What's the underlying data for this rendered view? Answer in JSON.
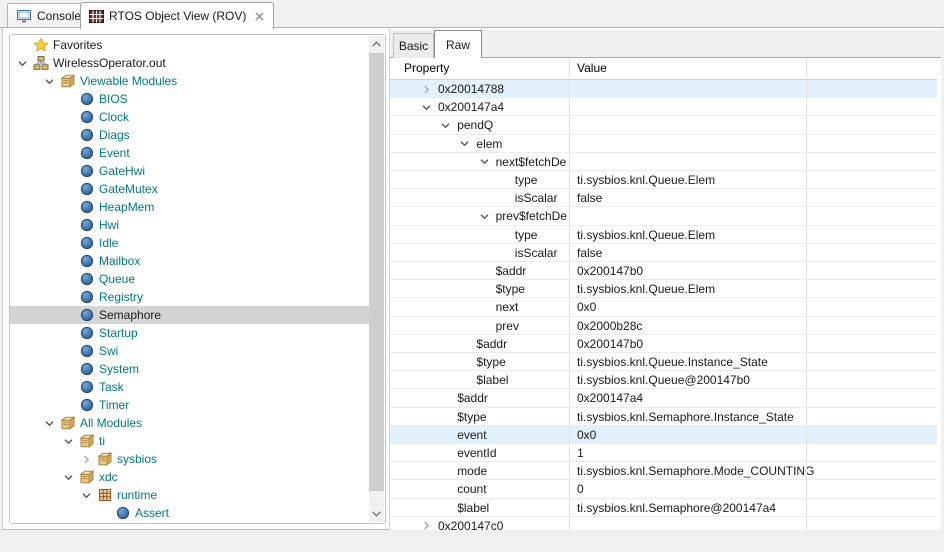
{
  "window": {
    "tabs": [
      {
        "label": "Console",
        "icon": "console-icon",
        "active": false
      },
      {
        "label": "RTOS Object View (ROV)",
        "icon": "table-grid-icon",
        "active": true,
        "closable": true
      }
    ]
  },
  "colors": {
    "module_teal": "#007a7a",
    "tree_selection": "#d4d4d4",
    "row_highlight": "#e3f1fc"
  },
  "tree": {
    "items": [
      {
        "label": "Favorites",
        "icon": "star",
        "level": 0,
        "chevron": "none",
        "color": "default"
      },
      {
        "label": "WirelessOperator.out",
        "icon": "hierarchy",
        "level": 0,
        "chevron": "expanded",
        "color": "default"
      },
      {
        "label": "Viewable Modules",
        "icon": "package",
        "level": 1,
        "chevron": "expanded",
        "color": "teal"
      },
      {
        "label": "BIOS",
        "icon": "module",
        "level": 2,
        "chevron": "none",
        "color": "teal"
      },
      {
        "label": "Clock",
        "icon": "module",
        "level": 2,
        "chevron": "none",
        "color": "teal"
      },
      {
        "label": "Diags",
        "icon": "module",
        "level": 2,
        "chevron": "none",
        "color": "teal"
      },
      {
        "label": "Event",
        "icon": "module",
        "level": 2,
        "chevron": "none",
        "color": "teal"
      },
      {
        "label": "GateHwi",
        "icon": "module",
        "level": 2,
        "chevron": "none",
        "color": "teal"
      },
      {
        "label": "GateMutex",
        "icon": "module",
        "level": 2,
        "chevron": "none",
        "color": "teal"
      },
      {
        "label": "HeapMem",
        "icon": "module",
        "level": 2,
        "chevron": "none",
        "color": "teal"
      },
      {
        "label": "Hwi",
        "icon": "module",
        "level": 2,
        "chevron": "none",
        "color": "teal"
      },
      {
        "label": "Idle",
        "icon": "module",
        "level": 2,
        "chevron": "none",
        "color": "teal"
      },
      {
        "label": "Mailbox",
        "icon": "module",
        "level": 2,
        "chevron": "none",
        "color": "teal"
      },
      {
        "label": "Queue",
        "icon": "module",
        "level": 2,
        "chevron": "none",
        "color": "teal"
      },
      {
        "label": "Registry",
        "icon": "module",
        "level": 2,
        "chevron": "none",
        "color": "teal"
      },
      {
        "label": "Semaphore",
        "icon": "module",
        "level": 2,
        "chevron": "none",
        "color": "default",
        "selected": true
      },
      {
        "label": "Startup",
        "icon": "module",
        "level": 2,
        "chevron": "none",
        "color": "teal"
      },
      {
        "label": "Swi",
        "icon": "module",
        "level": 2,
        "chevron": "none",
        "color": "teal"
      },
      {
        "label": "System",
        "icon": "module",
        "level": 2,
        "chevron": "none",
        "color": "teal"
      },
      {
        "label": "Task",
        "icon": "module",
        "level": 2,
        "chevron": "none",
        "color": "teal"
      },
      {
        "label": "Timer",
        "icon": "module",
        "level": 2,
        "chevron": "none",
        "color": "teal"
      },
      {
        "label": "All Modules",
        "icon": "package",
        "level": 1,
        "chevron": "expanded",
        "color": "teal"
      },
      {
        "label": "ti",
        "icon": "package",
        "level": 2,
        "chevron": "expanded",
        "color": "teal"
      },
      {
        "label": "sysbios",
        "icon": "package",
        "level": 3,
        "chevron": "collapsed",
        "color": "teal"
      },
      {
        "label": "xdc",
        "icon": "package",
        "level": 2,
        "chevron": "expanded",
        "color": "teal"
      },
      {
        "label": "runtime",
        "icon": "grid-module",
        "level": 3,
        "chevron": "expanded",
        "color": "teal"
      },
      {
        "label": "Assert",
        "icon": "module",
        "level": 4,
        "chevron": "none",
        "color": "teal"
      },
      {
        "label": "",
        "icon": "module",
        "level": 4,
        "chevron": "none",
        "color": "teal"
      }
    ]
  },
  "inspector": {
    "tabs": [
      {
        "label": "Basic",
        "active": false
      },
      {
        "label": "Raw",
        "active": true
      }
    ],
    "columns": [
      "Property",
      "Value"
    ],
    "rows": [
      {
        "property": "0x20014788",
        "value": "",
        "level": 0,
        "chevron": "collapsed",
        "highlight": true
      },
      {
        "property": "0x200147a4",
        "value": "",
        "level": 0,
        "chevron": "expanded"
      },
      {
        "property": "pendQ",
        "value": "",
        "level": 1,
        "chevron": "expanded"
      },
      {
        "property": "elem",
        "value": "",
        "level": 2,
        "chevron": "expanded"
      },
      {
        "property": "next$fetchDe",
        "value": "",
        "level": 3,
        "chevron": "expanded"
      },
      {
        "property": "type",
        "value": "ti.sysbios.knl.Queue.Elem",
        "level": 4,
        "chevron": "none"
      },
      {
        "property": "isScalar",
        "value": "false",
        "level": 4,
        "chevron": "none"
      },
      {
        "property": "prev$fetchDe",
        "value": "",
        "level": 3,
        "chevron": "expanded"
      },
      {
        "property": "type",
        "value": "ti.sysbios.knl.Queue.Elem",
        "level": 4,
        "chevron": "none"
      },
      {
        "property": "isScalar",
        "value": "false",
        "level": 4,
        "chevron": "none"
      },
      {
        "property": "$addr",
        "value": "0x200147b0",
        "level": 3,
        "chevron": "none"
      },
      {
        "property": "$type",
        "value": "ti.sysbios.knl.Queue.Elem",
        "level": 3,
        "chevron": "none"
      },
      {
        "property": "next",
        "value": "0x0",
        "level": 3,
        "chevron": "none"
      },
      {
        "property": "prev",
        "value": "0x2000b28c",
        "level": 3,
        "chevron": "none"
      },
      {
        "property": "$addr",
        "value": "0x200147b0",
        "level": 2,
        "chevron": "none"
      },
      {
        "property": "$type",
        "value": "ti.sysbios.knl.Queue.Instance_State",
        "level": 2,
        "chevron": "none"
      },
      {
        "property": "$label",
        "value": "ti.sysbios.knl.Queue@200147b0",
        "level": 2,
        "chevron": "none"
      },
      {
        "property": "$addr",
        "value": "0x200147a4",
        "level": 1,
        "chevron": "none"
      },
      {
        "property": "$type",
        "value": "ti.sysbios.knl.Semaphore.Instance_State",
        "level": 1,
        "chevron": "none"
      },
      {
        "property": "event",
        "value": "0x0",
        "level": 1,
        "chevron": "none",
        "highlight": true
      },
      {
        "property": "eventId",
        "value": "1",
        "level": 1,
        "chevron": "none"
      },
      {
        "property": "mode",
        "value": "ti.sysbios.knl.Semaphore.Mode_COUNTING",
        "level": 1,
        "chevron": "none"
      },
      {
        "property": "count",
        "value": "0",
        "level": 1,
        "chevron": "none"
      },
      {
        "property": "$label",
        "value": "ti.sysbios.knl.Semaphore@200147a4",
        "level": 1,
        "chevron": "none"
      },
      {
        "property": "0x200147c0",
        "value": "",
        "level": 0,
        "chevron": "collapsed"
      }
    ]
  }
}
